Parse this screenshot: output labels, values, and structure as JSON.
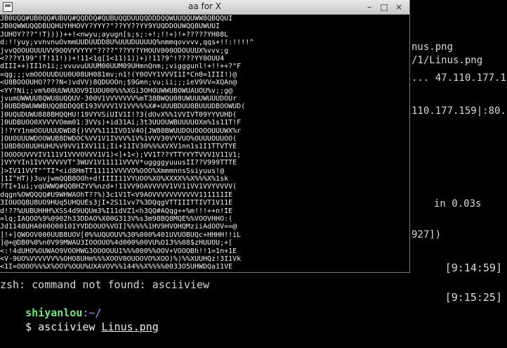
{
  "window": {
    "title": "aa for X",
    "min_label": "–",
    "max_label": "□",
    "close_label": "×"
  },
  "background_terminal": {
    "lines": [
      "nus.png",
      "/1/Linus.png",
      "... 47.110.177.1",
      "110.177.159|:80.",
      "in 0.03s",
      "927])"
    ],
    "times": [
      "[9:14:59]",
      "[9:15:25]"
    ],
    "status": "zsh: command not found: asciiview",
    "prompt": {
      "user": "shiyanlou",
      "path": ":~/",
      "symbol": "$",
      "command": " asciiview ",
      "file": "Linus.png"
    }
  },
  "ascii": {
    "lines": [
      "JB0UQQ#UB0QQ#UBUQ#QQDDQ#QUBUQQDUUQQDDDQQWUUQQUWW8QBQQUI",
      "JB0QWWUQQDBUQHUYHHOVY?YYY?\"??YY??YY9YUQDDOUWQQ8UWUUI",
      "JUHOY???\"!T))))++!<nwyu;ayugn[s;s;:+!;!!+)!+?????YH08L",
      "d:!!yuy;vvnvnuOvmmUUDUUDD8U%UUUDUUUUQ%nmmqovvvv,qqs+!!:!!!!^",
      "jvvQOOUOUUUVV9OOVYVYYY\"????\"??YY?YHOUV000ODOUUUX%vvv;g",
      "<???Y199\"!T!11!))+!11<1q[1<11)1))+)!11?9^!????YY0OUU4",
      "dIII++)II1n1i;;vvuvuUUUM00UUM09UHmnQnm;;vigggunl!+!!++?\"F",
      "=qg;;;vmOOOUUDUU0U08UH081mv;n1!(Y0OVY1VVVI1I*Cn0=1III!)@",
      "<U8BOOOUHO????N<)vdVV)8QDUOOn;$9Gmn;vu;ii;;;ieV9VV=XQAn@",
      "<YY?Ni;;vm%00UUWUUOV9IUOU00%%%XGi3OHOUWWUBOWUAUOU%v;;g@",
      "jvumUWWUU8QWU8UQQUV-300V1VVVVVVV%mT38BWQU08UWUUUWUUUDOUr",
      "]0UBDBWUWWBUQQBDDQQE193VVVV1V1VV%%%X#+UUUBDUU8BUUUDBOOWUD(",
      "]0UQUDUWU888BHQQHU!19VYVSiUIV1I!?3(dOvX%%1VVIVT09YYVUHD(",
      "]0UDBUOO0XVVVVOmm01:3VVs)+id31Ai;3t3UUOUWBUUUUOXm%1s11T!F",
      "]!?YY1nmOOUUUUDWD8{)VVV%111IVO1V4O[JW80BWUUDOUOOOOUUUWX%r",
      "]OUOUUUWDOOWUB8DWDOC%VV1V1IVVV%1V%1VVV30VYVUO%OUUUOUUOO(",
      "]U8D8O8UUHUHU%V9VV1IXV111;Ii+11IV30%%%XVXV1nn1s1I1TTVTYE",
      "]OOOOUVVVIV111V1VVVOVVV1V1)<]+1<);VV1T??YTTYYYTVVV1V11V1;",
      "]VYYYIn1IVVVVVVVT\"3WUV1V11111VVVV*uggggyuuusII??V999TTTE",
      "]>IV11VVT\"^TI*<id8HmTT11111VVVVO%OOO%XmmmnnsSsiyuus!@",
      "]1I^HT))3uvjwmQQB8OOh+d!IIII11VYUOO%XO%XXXX%%X%%%X%1sk",
      "?TI+1ui;vqUWWQ#QQBHZYV%nzd+!11VV9OAVVVVV1VV11VV1VVYVVVV(",
      "dqgn%OWQQQQ#U9WHWAOhT??%)3c1V1T<V9AOVVVVVVVVVVV111111IE",
      "3IOUOQ8U8UO9HUq5UHQUEs3jI+2S11vv7%3DQqgVTTIIITTIVT1V11E",
      "d!??%UUBUHHH%XSS4d9UQUm3%I11dVZ1<h3QQ#AQqg++%m!!!++n!IE",
      "=lq;IAQOO%9%0902h33DDAO%X00G313V%s3m98BQ8MQE%%VOOVHHO:(",
      "Jd1148UHA000O00101YVDDOUO%VOI]%%%%%1HV9HVOHQMziiAdOOV==@",
      "]!+]QWOOV000UUB8UOV[0%%UQUOUV%30%000%401UVUOBUQc+HHHH!!iL",
      "]@+@DB0%0%n0V99MWAU3IOOOUO%4d000%00VU%O13%%08$zHUUOU;+[",
      "<:!4dUHO%OUWAO9VOOHWG3OOOOUU1%%%000%%OOV+VOOOBh!!1=1n+1E",
      "<V-9UO%VVVVVV%%OHO8UHm%%%XOOV0OUOOVO%XOO)%)%%XUUHQz!3I1Vk",
      "<1I=OOOO%%%X%OOV%OUU%UXAVOV%%144%%X%%%%0033O5UHWDQa11VE"
    ]
  }
}
